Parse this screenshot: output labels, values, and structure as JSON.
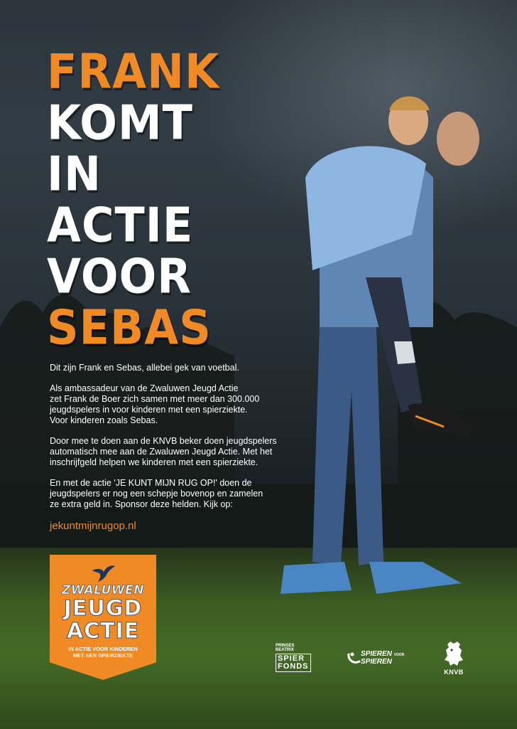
{
  "headline": {
    "line1": "FRANK",
    "line2": "KOMT",
    "line3": "IN",
    "line4": "ACTIE",
    "line5": "VOOR",
    "line6": "SEBAS"
  },
  "body": {
    "p1": "Dit zijn Frank en Sebas, allebei gek van voetbal.",
    "p2_l1": "Als ambassadeur van de Zwaluwen Jeugd Actie",
    "p2_l2": "zet Frank de Boer zich samen met meer dan 300.000",
    "p2_l3": "jeugdspelers in voor kinderen met een spierziekte.",
    "p2_l4": "Voor kinderen zoals Sebas.",
    "p3_l1": "Door mee te doen aan de KNVB beker doen jeugdspelers",
    "p3_l2": "automatisch mee aan de Zwaluwen Jeugd Actie. Met het",
    "p3_l3": "inschrijfgeld helpen we kinderen met een spierziekte.",
    "p4_l1": "En met de actie 'JE KUNT MIJN RUG OP!' doen de",
    "p4_l2": "jeugdspelers er nog een schepje bovenop en zamelen",
    "p4_l3": "ze extra geld in. Sponsor deze helden. Kijk op:",
    "url": "jekuntmijnrugop.nl"
  },
  "badge": {
    "line1": "ZWALUWEN",
    "line2": "JEUGD",
    "line3": "ACTIE",
    "tag1": "IN ACTIE VOOR KINDEREN",
    "tag2": "MET EEN SPIERZIEKTE"
  },
  "logos": {
    "spier_top1": "PRINSES",
    "spier_top2": "BEATRIX",
    "spier_box1": "SPIER",
    "spier_box2": "FONDS",
    "ss_line1": "SPIEREN",
    "ss_voor": "VOOR",
    "ss_line2": "SPIEREN",
    "knvb": "KNVB"
  },
  "colors": {
    "accent": "#f08a24",
    "text": "#ffffff",
    "badge_outline": "#1d3557"
  }
}
